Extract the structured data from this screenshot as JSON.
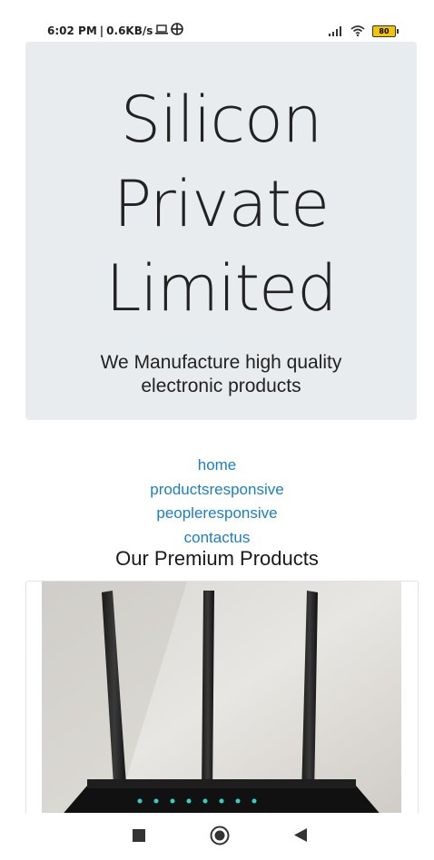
{
  "status_bar": {
    "time": "6:02 PM",
    "speed": "0.6KB/s",
    "battery": "80",
    "icons": [
      "laptop-icon",
      "network-globe-icon",
      "signal-icon",
      "wifi-icon",
      "battery-icon"
    ]
  },
  "hero": {
    "title_line1": "Silicon",
    "title_line2": "Private",
    "title_line3": "Limited",
    "subtitle": "We Manufacture high quality electronic products"
  },
  "nav": {
    "links": [
      "home",
      "productsresponsive",
      "peopleresponsive",
      "contactus"
    ]
  },
  "products": {
    "heading": "Our Premium Products"
  },
  "colors": {
    "link": "#1a7fc1",
    "hero_bg": "#e9ecef"
  },
  "android_nav": [
    "recents-square-icon",
    "home-circle-icon",
    "back-triangle-icon"
  ]
}
